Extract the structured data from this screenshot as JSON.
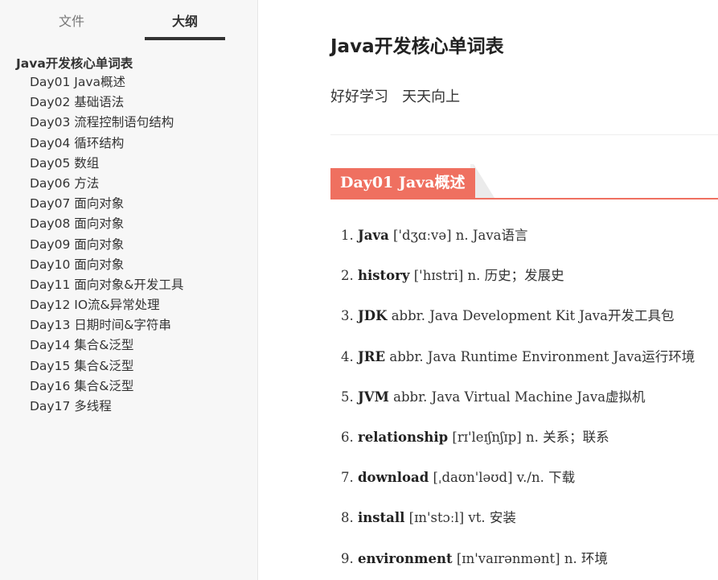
{
  "sidebar": {
    "tabs": {
      "files": "文件",
      "outline": "大纲"
    },
    "outline_root": "Java开发核心单词表",
    "outline_items": [
      "Day01 Java概述",
      "Day02 基础语法",
      "Day03 流程控制语句结构",
      "Day04 循环结构",
      "Day05 数组",
      "Day06 方法",
      "Day07 面向对象",
      "Day08 面向对象",
      "Day09 面向对象",
      "Day10 面向对象",
      "Day11 面向对象&开发工具",
      "Day12 IO流&异常处理",
      "Day13 日期时间&字符串",
      "Day14 集合&泛型",
      "Day15 集合&泛型",
      "Day16 集合&泛型",
      "Day17 多线程"
    ]
  },
  "main": {
    "title": "Java开发核心单词表",
    "subtitle": "好好学习   天天向上",
    "section_title": "Day01 Java概述",
    "accent_color": "#ef7060",
    "entries": [
      {
        "num": "1.",
        "word": "Java",
        "rest": "['dʒɑːvə] n. Java语言"
      },
      {
        "num": "2.",
        "word": "history",
        "rest": "['hɪstri] n. 历史；发展史"
      },
      {
        "num": "3.",
        "word": "JDK",
        "rest": "abbr. Java Development Kit Java开发工具包"
      },
      {
        "num": "4.",
        "word": "JRE",
        "rest": "abbr. Java Runtime Environment Java运行环境"
      },
      {
        "num": "5.",
        "word": "JVM",
        "rest": "abbr. Java Virtual Machine Java虚拟机"
      },
      {
        "num": "6.",
        "word": "relationship",
        "rest": "[rɪ'leɪʃnʃɪp] n. 关系；联系"
      },
      {
        "num": "7.",
        "word": "download",
        "rest": "[ˌdaʊn'ləʊd] v./n. 下载"
      },
      {
        "num": "8.",
        "word": "install",
        "rest": "[ɪn'stɔːl] vt. 安装"
      },
      {
        "num": "9.",
        "word": "environment",
        "rest": "[ɪn'vaɪrənmənt] n. 环境"
      }
    ]
  }
}
